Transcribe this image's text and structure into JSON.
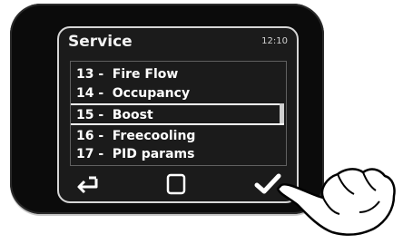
{
  "screen": {
    "title": "Service",
    "time": "12:10"
  },
  "menu": {
    "items": [
      {
        "num": "13 -",
        "label": "Fire Flow",
        "selected": false
      },
      {
        "num": "14 -",
        "label": "Occupancy",
        "selected": false
      },
      {
        "num": "15 -",
        "label": "Boost",
        "selected": true
      },
      {
        "num": "16 -",
        "label": "Freecooling",
        "selected": false
      },
      {
        "num": "17 -",
        "label": "PID params",
        "selected": false
      }
    ]
  },
  "buttons": {
    "back": "back-arrow-icon",
    "home": "square-icon",
    "confirm": "checkmark-icon"
  },
  "colors": {
    "device": "#0b0b0b",
    "screen": "#1b1b1b",
    "text": "#ffffff"
  }
}
